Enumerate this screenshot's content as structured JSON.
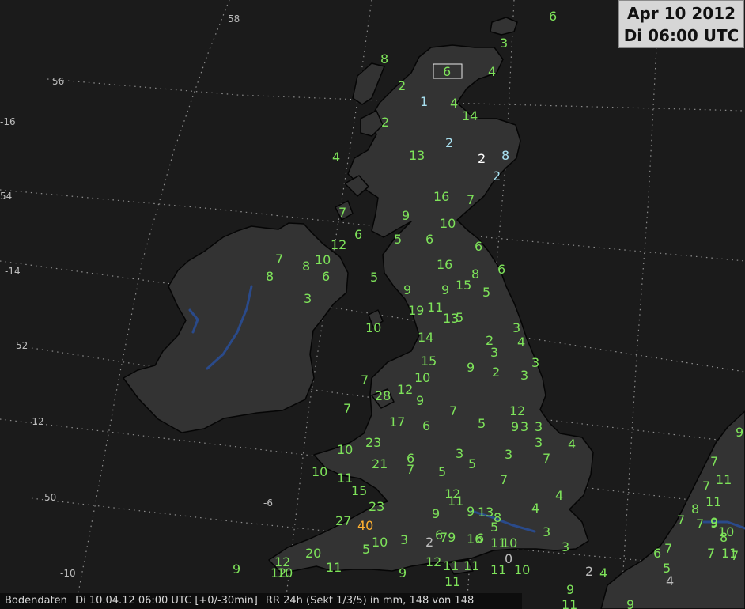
{
  "header": {
    "date": "Apr 10 2012",
    "time": "Di 06:00 UTC"
  },
  "footer": {
    "source": "Bodendaten",
    "timestamp": "Di 10.04.12 06:00 UTC [+0/-30min]",
    "parameter": "RR 24h (Sekt 1/3/5) in mm, 148 von 148"
  },
  "colors": {
    "background": "#1b1b1b",
    "land": "#333333",
    "coast": "#000000",
    "water": "#2a4a8a",
    "grid": "#9a9a9a",
    "value_green": "#7ee35a",
    "value_cyan": "#a8e0f0",
    "value_white": "#ffffff",
    "value_orange": "#ffb030",
    "value_grey": "#bdbdbd"
  },
  "grid_labels": [
    "58",
    "56",
    "-16",
    "54",
    "-14",
    "52",
    "-12",
    "50",
    "-10",
    "-6"
  ],
  "stations": [
    {
      "v": "6"
    },
    {
      "v": "3"
    },
    {
      "v": "8"
    },
    {
      "v": "6",
      "boxed": true
    },
    {
      "v": "4"
    },
    {
      "v": "2"
    },
    {
      "v": "1",
      "c": "cyan"
    },
    {
      "v": "4"
    },
    {
      "v": "2"
    },
    {
      "v": "14"
    },
    {
      "v": "2",
      "c": "cyan"
    },
    {
      "v": "4"
    },
    {
      "v": "13"
    },
    {
      "v": "2",
      "c": "white"
    },
    {
      "v": "8",
      "c": "cyan"
    },
    {
      "v": "2",
      "c": "cyan"
    },
    {
      "v": "16"
    },
    {
      "v": "7"
    },
    {
      "v": "7"
    },
    {
      "v": "9"
    },
    {
      "v": "10"
    },
    {
      "v": "6"
    },
    {
      "v": "5"
    },
    {
      "v": "6"
    },
    {
      "v": "12"
    },
    {
      "v": "6"
    },
    {
      "v": "7"
    },
    {
      "v": "8"
    },
    {
      "v": "10"
    },
    {
      "v": "16"
    },
    {
      "v": "8"
    },
    {
      "v": "6"
    },
    {
      "v": "6"
    },
    {
      "v": "5"
    },
    {
      "v": "9"
    },
    {
      "v": "9"
    },
    {
      "v": "15"
    },
    {
      "v": "8"
    },
    {
      "v": "5"
    },
    {
      "v": "3"
    },
    {
      "v": "19"
    },
    {
      "v": "11"
    },
    {
      "v": "13"
    },
    {
      "v": "5"
    },
    {
      "v": "10"
    },
    {
      "v": "3"
    },
    {
      "v": "14"
    },
    {
      "v": "2"
    },
    {
      "v": "4"
    },
    {
      "v": "3"
    },
    {
      "v": "3"
    },
    {
      "v": "15"
    },
    {
      "v": "9"
    },
    {
      "v": "2"
    },
    {
      "v": "3"
    },
    {
      "v": "7"
    },
    {
      "v": "10"
    },
    {
      "v": "12"
    },
    {
      "v": "9"
    },
    {
      "v": "28"
    },
    {
      "v": "7"
    },
    {
      "v": "7"
    },
    {
      "v": "12"
    },
    {
      "v": "5"
    },
    {
      "v": "17"
    },
    {
      "v": "6"
    },
    {
      "v": "9"
    },
    {
      "v": "3"
    },
    {
      "v": "3"
    },
    {
      "v": "3"
    },
    {
      "v": "23"
    },
    {
      "v": "4"
    },
    {
      "v": "10"
    },
    {
      "v": "6"
    },
    {
      "v": "3"
    },
    {
      "v": "3"
    },
    {
      "v": "21"
    },
    {
      "v": "7"
    },
    {
      "v": "5"
    },
    {
      "v": "7"
    },
    {
      "v": "10"
    },
    {
      "v": "5"
    },
    {
      "v": "11"
    },
    {
      "v": "7"
    },
    {
      "v": "15"
    },
    {
      "v": "12"
    },
    {
      "v": "4"
    },
    {
      "v": "11"
    },
    {
      "v": "4"
    },
    {
      "v": "23"
    },
    {
      "v": "13"
    },
    {
      "v": "9"
    },
    {
      "v": "27"
    },
    {
      "v": "40",
      "c": "orange"
    },
    {
      "v": "8"
    },
    {
      "v": "5"
    },
    {
      "v": "9"
    },
    {
      "v": "6"
    },
    {
      "v": "3"
    },
    {
      "v": "20"
    },
    {
      "v": "5"
    },
    {
      "v": "10"
    },
    {
      "v": "3"
    },
    {
      "v": "2",
      "c": "grey"
    },
    {
      "v": "79"
    },
    {
      "v": "16"
    },
    {
      "v": "6"
    },
    {
      "v": "11"
    },
    {
      "v": "10"
    },
    {
      "v": "3"
    },
    {
      "v": "12"
    },
    {
      "v": "9"
    },
    {
      "v": "12"
    },
    {
      "v": "10"
    },
    {
      "v": "11"
    },
    {
      "v": "9"
    },
    {
      "v": "12"
    },
    {
      "v": "11"
    },
    {
      "v": "11"
    },
    {
      "v": "11"
    },
    {
      "v": "10"
    },
    {
      "v": "0",
      "c": "grey"
    },
    {
      "v": "11"
    },
    {
      "v": "2",
      "c": "grey"
    },
    {
      "v": "4"
    },
    {
      "v": "9"
    },
    {
      "v": "11"
    },
    {
      "v": "9"
    },
    {
      "v": "7"
    },
    {
      "v": "9"
    },
    {
      "v": "7"
    },
    {
      "v": "11"
    },
    {
      "v": "7"
    },
    {
      "v": "8"
    },
    {
      "v": "11"
    },
    {
      "v": "7"
    },
    {
      "v": "9"
    },
    {
      "v": "9"
    },
    {
      "v": "10"
    },
    {
      "v": "8"
    },
    {
      "v": "6"
    },
    {
      "v": "7"
    },
    {
      "v": "5"
    },
    {
      "v": "7"
    },
    {
      "v": "11"
    },
    {
      "v": "7"
    },
    {
      "v": "4",
      "c": "grey"
    }
  ]
}
